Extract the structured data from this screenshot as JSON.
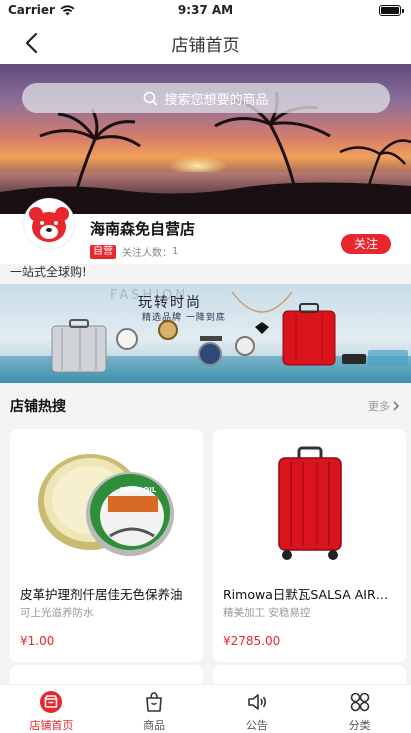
{
  "status_bar": {
    "carrier": "Carrier",
    "time": "9:37 AM"
  },
  "nav": {
    "title": "店铺首页"
  },
  "search": {
    "placeholder": "搜索您想要的商品"
  },
  "shop": {
    "name": "海南森免自营店",
    "self_tag": "自营",
    "followers_label": "关注人数：",
    "followers_count": "1",
    "follow_button": "关注",
    "slogan": "一站式全球购!"
  },
  "banner": {
    "watermark": "FASHION",
    "headline": "玩转时尚",
    "subline": "精选品牌 一降到底"
  },
  "hot_section": {
    "title": "店铺热搜",
    "more": "更多"
  },
  "products": [
    {
      "name": "皮革护理剂仟居佳无色保养油",
      "desc": "可上光滋养防水",
      "price": "¥1.00",
      "image_label": "MINK OIL"
    },
    {
      "name": "Rimowa日默瓦SALSA AIR旅行箱",
      "desc": "精美加工 安稳易控",
      "price": "¥2785.00"
    }
  ],
  "tabs": [
    {
      "label": "店铺首页",
      "icon": "store-icon",
      "active": true
    },
    {
      "label": "商品",
      "icon": "shopping-bag-icon",
      "active": false
    },
    {
      "label": "公告",
      "icon": "speaker-icon",
      "active": false
    },
    {
      "label": "分类",
      "icon": "category-grid-icon",
      "active": false
    }
  ],
  "colors": {
    "accent": "#e8262e",
    "text": "#111111",
    "muted": "#999999",
    "background": "#f4f4f4"
  }
}
